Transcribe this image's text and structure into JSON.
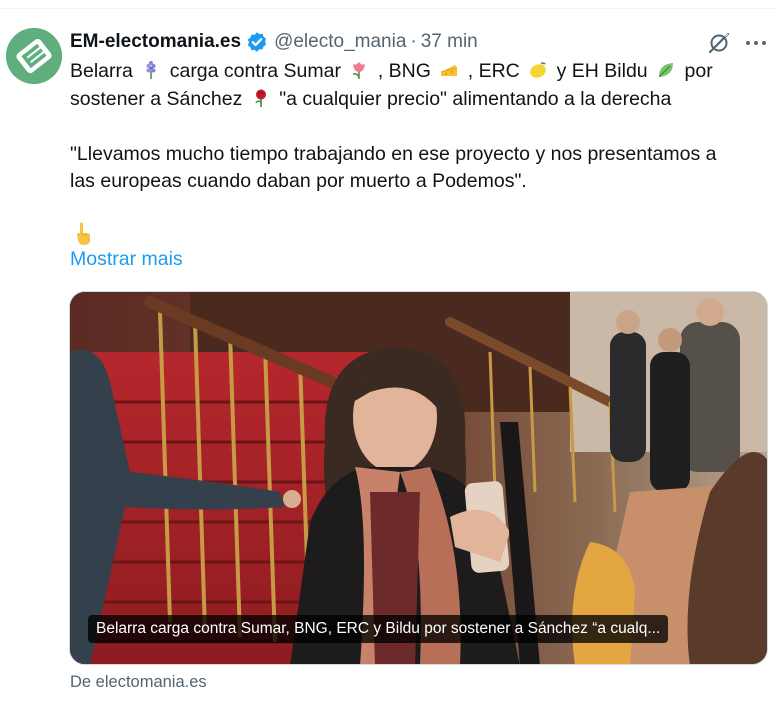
{
  "tweet": {
    "display_name": "EM-electomania.es",
    "handle": "@electo_mania",
    "separator": "·",
    "time": "37 min",
    "text": {
      "line1_a": "Belarra",
      "line1_b": "carga contra Sumar",
      "line1_c": ", BNG",
      "line1_d": ", ERC",
      "line1_e": "y EH Bildu",
      "line1_f": "por",
      "line2_a": "sostener a Sánchez",
      "line2_b": "\"a cualquier precio\" alimentando a la derecha",
      "line3": "\"Llevamos mucho tiempo trabajando en ese proyecto y nos presentamos a",
      "line4": "las europeas cuando daban por muerto a Podemos\"."
    },
    "show_more": "Mostrar mais",
    "card": {
      "caption": "Belarra carga contra Sumar, BNG, ERC y Bildu por sostener a Sánchez “a cualq..."
    },
    "source": "De electomania.es"
  },
  "icons": {
    "avatar": "electomania-logo",
    "verified": "verified-badge-icon",
    "grok": "grok-icon",
    "more": "more-icon",
    "emojis": [
      "grape-hyacinth-emoji",
      "tulip-emoji",
      "cheese-emoji",
      "lemon-emoji",
      "leaf-emoji",
      "rose-emoji",
      "pointing-down-emoji"
    ]
  },
  "colors": {
    "link_blue": "#1d9bf0",
    "secondary_text": "#536471",
    "avatar_green": "#5fae7d",
    "verified_blue": "#1d9bf0"
  }
}
